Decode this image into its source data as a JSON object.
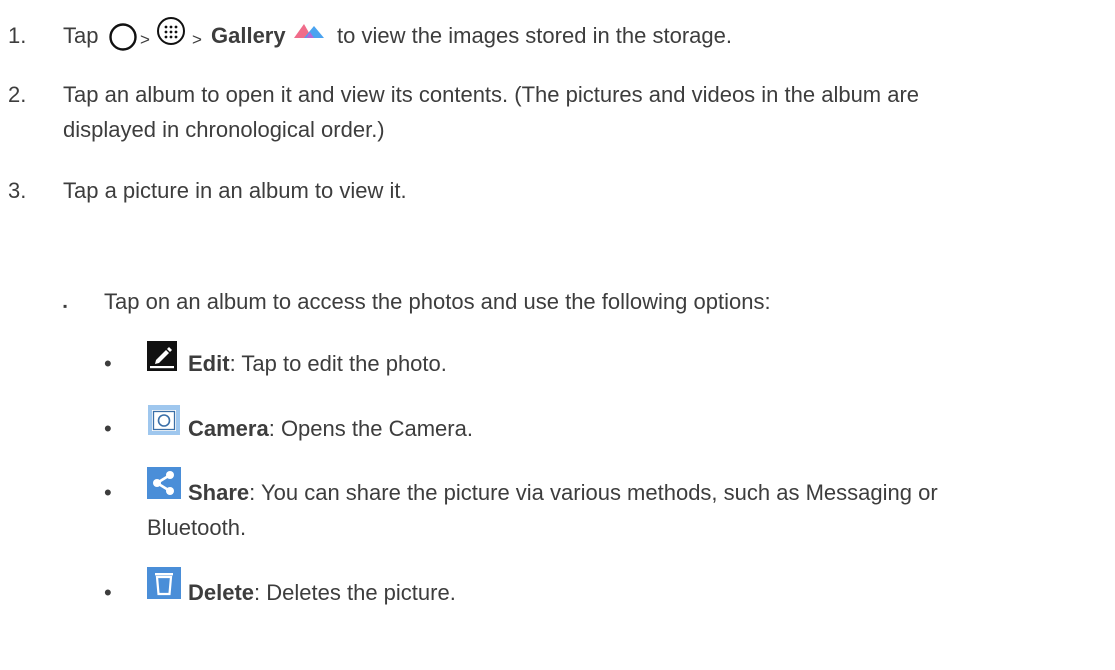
{
  "steps": [
    {
      "number": "1.",
      "tap": "Tap",
      "sep1": ">",
      "sep2": ">",
      "gallery": "Gallery",
      "rest": "to view the images stored in the storage.",
      "icons": [
        "home-icon",
        "apps-icon",
        "gallery-icon"
      ]
    },
    {
      "number": "2.",
      "line1": "Tap an album to open it and view its contents. (The pictures and videos in the album are",
      "line2": "displayed in chronological order.)"
    },
    {
      "number": "3.",
      "text": "Tap a picture in an album to view it."
    }
  ],
  "sub": {
    "bullet": "▪",
    "text": "Tap on an album to access the photos and use the following options:"
  },
  "options": [
    {
      "bullet": "•",
      "icon": "edit-icon",
      "name": "Edit",
      "desc": ": Tap to edit the photo."
    },
    {
      "bullet": "•",
      "icon": "camera-icon",
      "name": "Camera",
      "desc": ": Opens the Camera."
    },
    {
      "bullet": "•",
      "icon": "share-icon",
      "name": "Share",
      "desc": ": You can share the picture via various methods, such as Messaging or",
      "desc2": "Bluetooth."
    },
    {
      "bullet": "•",
      "icon": "trash-icon",
      "name": "Delete",
      "desc": ": Deletes the picture."
    }
  ],
  "colors": {
    "text": "#3d3d3d",
    "icon_blue": "#4a8ed8",
    "icon_dark": "#111111",
    "gallery_pink": "#f06c8a",
    "gallery_blue": "#4aa3f0"
  }
}
